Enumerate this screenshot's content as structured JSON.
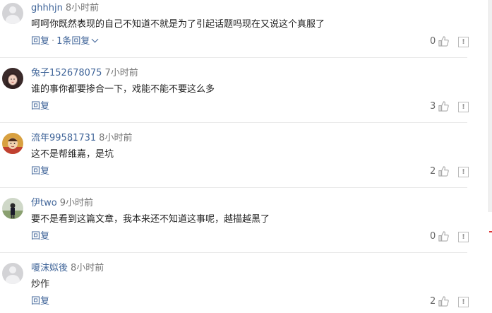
{
  "comments": [
    {
      "user": "ghhhjn",
      "time": "8小时前",
      "text": "呵呵你既然表现的自己不知道不就是为了引起话题吗现在又说这个真服了",
      "reply_label": "回复",
      "replies_label": "1条回复",
      "likes": "0",
      "avatar": "default"
    },
    {
      "user": "兔子152678075",
      "time": "7小时前",
      "text": "谁的事你都要掺合一下，戏能不能不要这么多",
      "reply_label": "回复",
      "likes": "3",
      "avatar": "photo-girl"
    },
    {
      "user": "流年99581731",
      "time": "8小时前",
      "text": "这不是帮维嘉，是坑",
      "reply_label": "回复",
      "likes": "2",
      "avatar": "photo-child"
    },
    {
      "user": "伊two",
      "time": "9小时前",
      "text": "要不是看到这篇文章，我本来还不知道这事呢，越描越黑了",
      "reply_label": "回复",
      "likes": "0",
      "avatar": "photo-outdoor"
    },
    {
      "user": "嗄沫姒後",
      "time": "8小时前",
      "text": "炒作",
      "reply_label": "回复",
      "likes": "2",
      "avatar": "default"
    }
  ],
  "icons": {
    "like": "thumbs-up-icon",
    "report": "report-icon",
    "expand": "chevron-down-icon"
  },
  "colors": {
    "link": "#406599",
    "text": "#222222",
    "meta": "#777777"
  }
}
